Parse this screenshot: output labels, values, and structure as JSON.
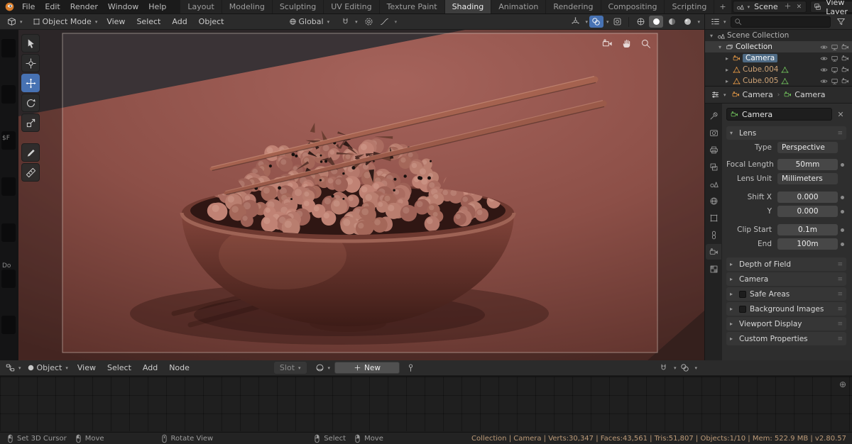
{
  "icons": {
    "dropdown": "▾",
    "expand_open": "▾",
    "expand_closed": "▸",
    "plus_tab": "+",
    "close": "✕",
    "grip": "≡",
    "plus_circle": "⊕",
    "crumb_sep": "›"
  },
  "topbar": {
    "menus": [
      "File",
      "Edit",
      "Render",
      "Window",
      "Help"
    ],
    "tabs": [
      "Layout",
      "Modeling",
      "Sculpting",
      "UV Editing",
      "Texture Paint",
      "Shading",
      "Animation",
      "Rendering",
      "Compositing",
      "Scripting"
    ],
    "active_tab": "Shading",
    "scene_label": "Scene",
    "view_layer_label": "View Layer"
  },
  "viewport": {
    "mode": "Object Mode",
    "menus": [
      "View",
      "Select",
      "Add",
      "Object"
    ],
    "orientation": "Global",
    "edge_texts": [
      "$F",
      "Do"
    ]
  },
  "outliner": {
    "rows": [
      {
        "label": "Scene Collection"
      },
      {
        "label": "Collection"
      },
      {
        "label": "Camera"
      },
      {
        "label": "Cube.004"
      },
      {
        "label": "Cube.005"
      }
    ]
  },
  "properties": {
    "breadcrumb": [
      "Camera",
      "Camera"
    ],
    "id_name": "Camera",
    "lens_title": "Lens",
    "type_label": "Type",
    "type_value": "Perspective",
    "focal_label": "Focal Length",
    "focal_value": "50mm",
    "unit_label": "Lens Unit",
    "unit_value": "Millimeters",
    "shiftx_label": "Shift X",
    "shiftx_value": "0.000",
    "shifty_label": "Y",
    "shifty_value": "0.000",
    "clip_label": "Clip Start",
    "clip_value": "0.1m",
    "end_label": "End",
    "end_value": "100m",
    "sections": [
      "Depth of Field",
      "Camera",
      "Safe Areas",
      "Background Images",
      "Viewport Display",
      "Custom Properties"
    ]
  },
  "shader": {
    "type_value": "Object",
    "menus": [
      "View",
      "Select",
      "Add",
      "Node"
    ],
    "slot_label": "Slot",
    "new_label": "New"
  },
  "statusbar": {
    "hints": [
      "Set 3D Cursor",
      "Move",
      "Rotate View",
      "Select",
      "Move"
    ],
    "stats": "Collection | Camera | Verts:30,347 | Faces:43,561 | Tris:51,807 | Objects:1/10 | Mem: 522.9 MB | v2.80.57"
  },
  "colors": {
    "accent_blue": "#4772b3",
    "object_orange": "#e79a46",
    "data_green": "#71c15c"
  }
}
